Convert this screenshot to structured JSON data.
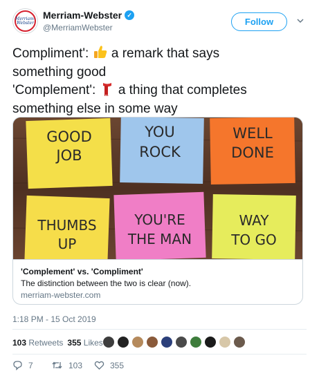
{
  "account": {
    "name": "Merriam-Webster",
    "handle": "@MerriamWebster",
    "avatar_text_1": "Merriam-",
    "avatar_text_2": "Webster",
    "follow_label": "Follow"
  },
  "tweet": {
    "line1_prefix": "Compliment':",
    "line1_suffix": "a remark that says",
    "line2": "something good",
    "line3_prefix": "'Complement':",
    "line3_suffix": "a thing that completes",
    "line4": "something else in some way"
  },
  "card": {
    "title": "'Complement' vs. 'Compliment'",
    "description": "The distinction between the two is clear (now).",
    "domain": "merriam-webster.com",
    "notes": [
      {
        "text1": "GOOD",
        "text2": "JOB",
        "color": "#f6e24b"
      },
      {
        "text1": "YOU",
        "text2": "ROCK",
        "color": "#9fc6ec"
      },
      {
        "text1": "WELL",
        "text2": "DONE",
        "color": "#f5762c"
      },
      {
        "text1": "THUMBS",
        "text2": "UP",
        "color": "#f6dd4a"
      },
      {
        "text1": "YOU'RE",
        "text2": "THE MAN",
        "color": "#f07ec6"
      },
      {
        "text1": "WAY",
        "text2": "TO GO",
        "color": "#e6ec5c"
      }
    ]
  },
  "timestamp": "1:18 PM - 15 Oct 2019",
  "stats": {
    "retweets_count": "103",
    "retweets_label": "Retweets",
    "likes_count": "355",
    "likes_label": "Likes"
  },
  "actions": {
    "reply_count": "7",
    "retweet_count": "103",
    "like_count": "355"
  },
  "colors": {
    "accent": "#1da1f2",
    "secondary_text": "#657786"
  },
  "icons": [
    "verified-badge-icon",
    "chevron-down-icon",
    "thumbs-up-emoji",
    "scarf-emoji",
    "reply-icon",
    "retweet-icon",
    "heart-icon"
  ]
}
